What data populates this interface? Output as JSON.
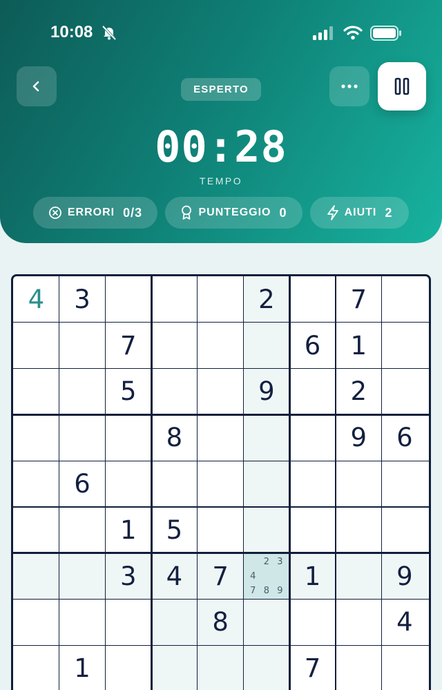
{
  "status": {
    "time": "10:08",
    "icons": [
      "bell-off-icon",
      "signal-icon",
      "wifi-icon",
      "battery-icon"
    ]
  },
  "header": {
    "difficulty": "ESPERTO",
    "timer": "00:28",
    "timer_label": "TEMPO",
    "icons": {
      "back": "chevron-left-icon",
      "more": "more-dots-icon",
      "pause": "pause-icon"
    },
    "stats": {
      "errors": {
        "label": "ERRORI",
        "value": "0/3",
        "icon": "x-circle-icon"
      },
      "score": {
        "label": "PUNTEGGIO",
        "value": "0",
        "icon": "award-icon"
      },
      "hints": {
        "label": "AIUTI",
        "value": "2",
        "icon": "bolt-icon"
      }
    }
  },
  "colors": {
    "accent": "#17b39f",
    "header_dark": "#0d5b57",
    "grid": "#0f1e3a",
    "digit": "#132040",
    "user_digit": "#2a8f8c",
    "selected": "#cfe7e7",
    "highlight": "#eff6f6"
  },
  "board": {
    "rows": [
      [
        "4",
        "3",
        "",
        "",
        "",
        "2",
        "",
        "7",
        ""
      ],
      [
        "",
        "",
        "7",
        "",
        "",
        "",
        "6",
        "1",
        ""
      ],
      [
        "",
        "",
        "5",
        "",
        "",
        "9",
        "",
        "2",
        ""
      ],
      [
        "",
        "",
        "",
        "8",
        "",
        "",
        "",
        "9",
        "6"
      ],
      [
        "",
        "6",
        "",
        "",
        "",
        "",
        "",
        "",
        ""
      ],
      [
        "",
        "",
        "1",
        "5",
        "",
        "",
        "",
        "",
        ""
      ],
      [
        "",
        "",
        "3",
        "4",
        "7",
        "",
        "1",
        "",
        "9"
      ],
      [
        "",
        "",
        "",
        "",
        "8",
        "",
        "",
        "",
        "4"
      ],
      [
        "",
        "1",
        "",
        "",
        "",
        "",
        "7",
        "",
        ""
      ]
    ],
    "user_entries": [
      [
        0,
        0
      ]
    ],
    "selected": [
      6,
      5
    ],
    "notes": {
      "cell": [
        6,
        5
      ],
      "digits": [
        "",
        "2",
        "3",
        "4",
        "",
        "",
        "7",
        "8",
        "9"
      ]
    }
  }
}
